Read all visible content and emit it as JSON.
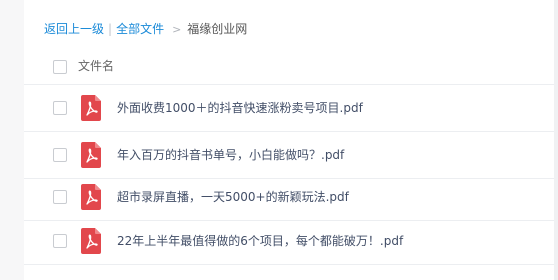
{
  "breadcrumb": {
    "back_label": "返回上一级",
    "separator": "|",
    "all_files_label": "全部文件",
    "arrow": ">",
    "current_folder": "福缘创业网"
  },
  "header": {
    "name_column_label": "文件名"
  },
  "files": [
    {
      "name": "外面收费1000＋的抖音快速涨粉卖号项目.pdf",
      "icon": "pdf-file-icon"
    },
    {
      "name": "年入百万的抖音书单号，小白能做吗？.pdf",
      "icon": "pdf-file-icon"
    },
    {
      "name": "超市录屏直播，一天5000+的新颖玩法.pdf",
      "icon": "pdf-file-icon"
    },
    {
      "name": "22年上半年最值得做的6个项目，每个都能破万！.pdf",
      "icon": "pdf-file-icon"
    }
  ],
  "colors": {
    "link": "#1a8ad8",
    "pdf_red": "#e2474c",
    "text": "#424e67"
  }
}
